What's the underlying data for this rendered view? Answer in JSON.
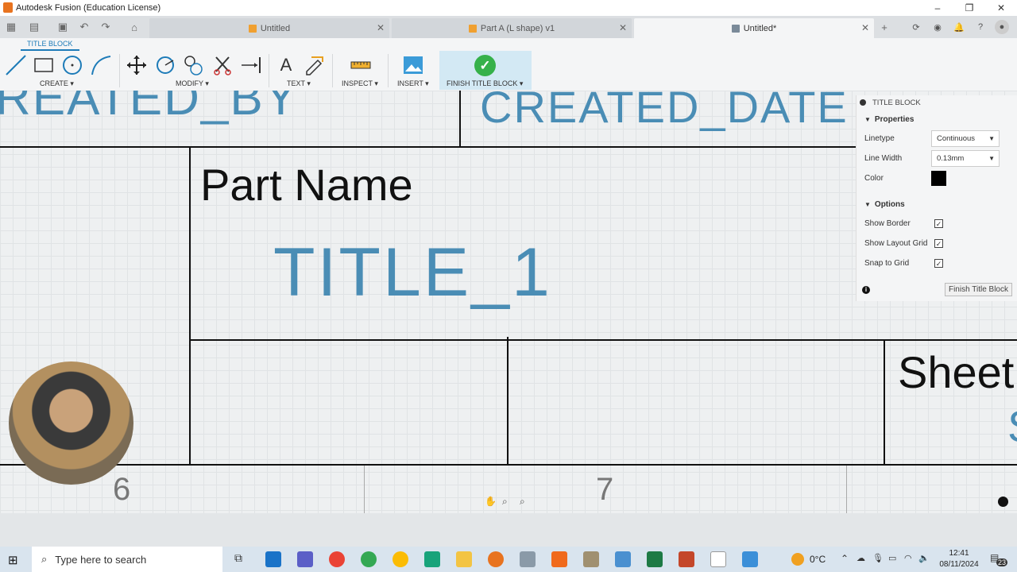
{
  "window": {
    "title": "Autodesk Fusion (Education License)",
    "minimize": "–",
    "maximize": "❐",
    "close": "✕"
  },
  "tabs": [
    {
      "label": "Untitled",
      "close": "✕"
    },
    {
      "label": "Part A (L shape) v1",
      "close": "✕"
    },
    {
      "label": "Untitled*",
      "close": "✕"
    }
  ],
  "toolbar": {
    "context_tab": "TITLE BLOCK",
    "groups": {
      "create": "CREATE ▾",
      "modify": "MODIFY ▾",
      "text": "TEXT ▾",
      "inspect": "INSPECT ▾",
      "insert": "INSERT ▾",
      "finish": "FINISH TITLE BLOCK ▾"
    },
    "finish_check": "✓",
    "text_tool": "A"
  },
  "canvas": {
    "created_by": "REATED_BY",
    "created_date": "CREATED_DATE",
    "part_name": "Part Name",
    "title": "TITLE_1",
    "sheet": "Sheet",
    "sheet_fragment": "S",
    "zone_6": "6",
    "zone_7": "7"
  },
  "panel": {
    "title": "TITLE BLOCK",
    "properties_header": "Properties",
    "linetype_label": "Linetype",
    "linetype_value": "Continuous",
    "line_width_label": "Line Width",
    "line_width_value": "0.13mm",
    "color_label": "Color",
    "color_value": "#000000",
    "options_header": "Options",
    "show_border": "Show Border",
    "show_layout_grid": "Show Layout Grid",
    "snap_to_grid": "Snap to Grid",
    "checkmark": "✓",
    "finish_button": "Finish Title Block",
    "info": "i"
  },
  "taskbar": {
    "search_placeholder": "Type here to search",
    "temperature": "0°C",
    "time": "12:41",
    "date": "08/11/2024",
    "notifications": "23"
  }
}
